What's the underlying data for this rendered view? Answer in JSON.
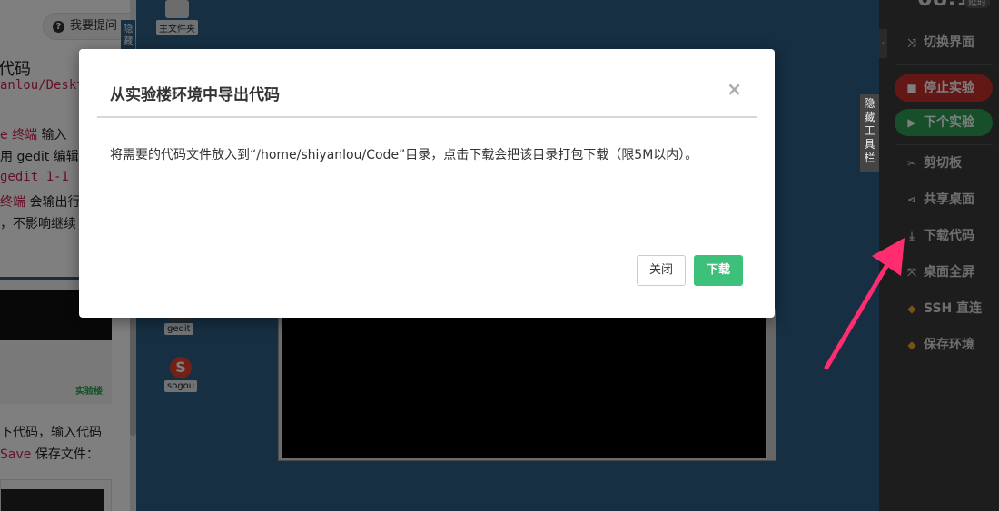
{
  "left_panel": {
    "ask_button": "我要提问",
    "hide_tab": "隐藏",
    "heading": "代码",
    "lines": [
      {
        "text": "anlou/Deskt",
        "style": "red-mono"
      },
      {
        "prefix": "e 终端",
        "text": " 输入",
        "style": "mixed"
      },
      {
        "text": "用 gedit 编辑器",
        "style": "plain"
      },
      {
        "text": " gedit 1-1",
        "style": "red-mono"
      },
      {
        "prefix": "终端",
        "text": " 会输出行",
        "style": "mixed"
      },
      {
        "text": "，不影响继续",
        "style": "plain"
      }
    ],
    "thumbnail_brand": "实验楼",
    "bottom_lines": [
      {
        "text": "下代码，输入代码"
      },
      {
        "prefix": "Save",
        "text": " 保存文件："
      }
    ]
  },
  "desktop": {
    "icons": [
      {
        "name": "主文件夹"
      },
      {
        "name": "gedit"
      },
      {
        "name": "sogou"
      }
    ]
  },
  "toolbar": {
    "timer": "08:10",
    "timer_tag": "延时",
    "hide_tab": "隐藏工具栏",
    "items": [
      {
        "icon": "shuffle-icon",
        "glyph": "⤨",
        "label": "切换界面"
      },
      {
        "icon": "stop-icon",
        "glyph": "■",
        "label": "停止实验"
      },
      {
        "icon": "step-forward-icon",
        "glyph": "▶",
        "label": "下个实验"
      },
      {
        "icon": "scissors-icon",
        "glyph": "✂",
        "label": "剪切板"
      },
      {
        "icon": "share-icon",
        "glyph": "⋖",
        "label": "共享桌面"
      },
      {
        "icon": "download-icon",
        "glyph": "⤓",
        "label": "下载代码"
      },
      {
        "icon": "fullscreen-icon",
        "glyph": "⤧",
        "label": "桌面全屏"
      },
      {
        "icon": "gem-icon",
        "glyph": "◆",
        "label": "SSH 直连"
      },
      {
        "icon": "gem-icon",
        "glyph": "◆",
        "label": "保存环境"
      }
    ]
  },
  "modal": {
    "title": "从实验楼环境中导出代码",
    "close_glyph": "×",
    "body": "将需要的代码文件放入到“/home/shiyanlou/Code”目录，点击下载会把该目录打包下载（限5M以内）。",
    "buttons": {
      "close": "关闭",
      "download": "下载"
    }
  },
  "colors": {
    "download_button": "#3cc07a",
    "stop_button": "#c9302c",
    "next_button": "#2e9e56",
    "annotation_arrow": "#ff2d6f"
  }
}
